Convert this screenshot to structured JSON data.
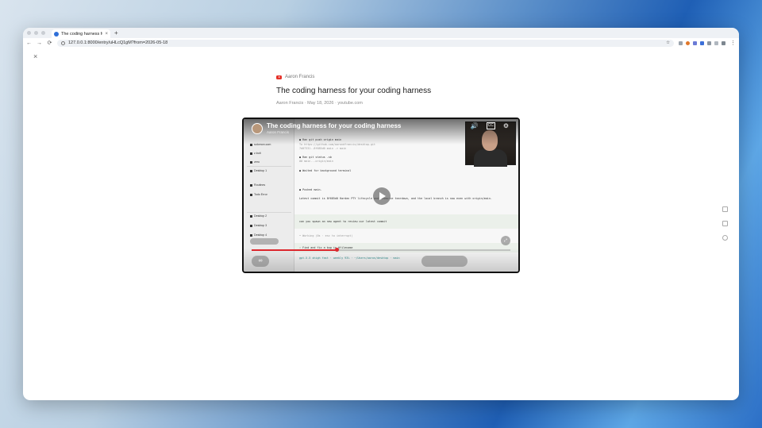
{
  "browser": {
    "tab_title": "The coding harness for y",
    "tab_close": "×",
    "new_tab": "+",
    "url": "127.0.0.1:8000/entry/uHLcQ1gM?from=2026-05-18",
    "nav_back": "←",
    "nav_forward": "→",
    "nav_reload": "⟳",
    "star": "☆",
    "menu": "⋮"
  },
  "page": {
    "close": "×",
    "source_name": "Aaron Francis",
    "title": "The coding harness for your coding harness",
    "meta": "Aaron Francis · May 18, 2026 · youtube.com"
  },
  "video": {
    "title": "The coding harness for your coding harness",
    "channel": "Aaron Francis",
    "progress": 0.33,
    "mute_icon": "🔊",
    "cc_icon": "CC",
    "settings_icon": "⚙",
    "link_icon": "∞",
    "fullscreen_icon": "⤢",
    "sidebar_items": [
      "solomon.com",
      "z.bolt",
      "zero",
      "Desktop 1",
      "Desktop 2",
      "Desktop 3",
      "Desktop 4"
    ],
    "sidebar_sub": [
      "Routines",
      "Todo Error"
    ],
    "terminal": [
      "● Ran git push origin main",
      "  To https://github.com/aarondfrancis/desktop.git",
      "    7d07331..8f685d0  main -> main",
      "● Ran git status -sb",
      "  ## main...origin/main",
      "● Waited for background terminal",
      "● Pushed main.",
      "  Latest commit is 8f685d0 Harden PTY lifecycle and resource teardown, and the local branch is now even with origin/main.",
      "can you spawn an new agent to review our latest commit",
      "• Working (0s · esc to interrupt)",
      "› Find and fix a bug in @filename",
      "  gpt-5.5 xhigh fast · weekly 93% · ~/Users/aaron/desktop · main"
    ]
  },
  "colors": {
    "accent_red": "#e0282e",
    "youtube_red": "#e6332a",
    "browser_blue": "#2f6fd8"
  }
}
